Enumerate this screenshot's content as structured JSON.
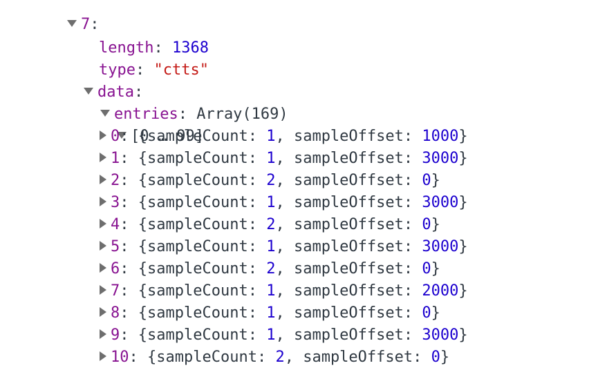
{
  "node": {
    "index_label": "7",
    "length": {
      "key": "length",
      "value": "1368"
    },
    "type": {
      "key": "type",
      "value": "\"ctts\""
    },
    "data": {
      "key": "data",
      "entries": {
        "key": "entries",
        "summary": "Array(169)",
        "range_label": "[0 … 99]",
        "field_count_key": "sampleCount",
        "field_offset_key": "sampleOffset",
        "items": [
          {
            "index": "0",
            "sampleCount": "1",
            "sampleOffset": "1000"
          },
          {
            "index": "1",
            "sampleCount": "1",
            "sampleOffset": "3000"
          },
          {
            "index": "2",
            "sampleCount": "2",
            "sampleOffset": "0"
          },
          {
            "index": "3",
            "sampleCount": "1",
            "sampleOffset": "3000"
          },
          {
            "index": "4",
            "sampleCount": "2",
            "sampleOffset": "0"
          },
          {
            "index": "5",
            "sampleCount": "1",
            "sampleOffset": "3000"
          },
          {
            "index": "6",
            "sampleCount": "2",
            "sampleOffset": "0"
          },
          {
            "index": "7",
            "sampleCount": "1",
            "sampleOffset": "2000"
          },
          {
            "index": "8",
            "sampleCount": "1",
            "sampleOffset": "0"
          },
          {
            "index": "9",
            "sampleCount": "1",
            "sampleOffset": "3000"
          },
          {
            "index": "10",
            "sampleCount": "2",
            "sampleOffset": "0"
          }
        ]
      }
    }
  },
  "colors": {
    "key": "#881391",
    "number": "#1c00cf",
    "string": "#c41a16",
    "text": "#303942",
    "toggle": "#6e6e6e"
  },
  "icons": {
    "expanded": "triangle-down-icon",
    "collapsed": "triangle-right-icon"
  }
}
